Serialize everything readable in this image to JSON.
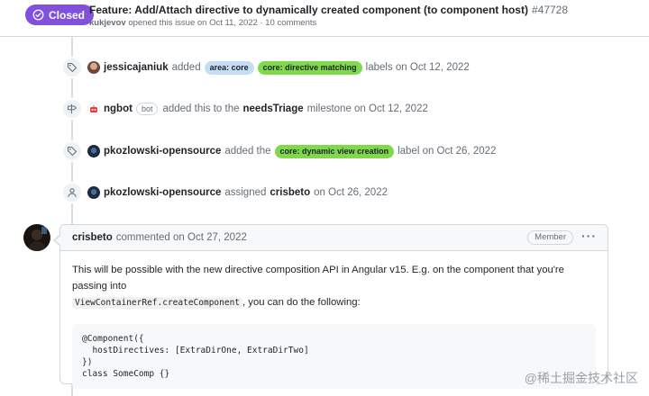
{
  "issue": {
    "state": "Closed",
    "title": "Feature: Add/Attach directive to dynamically created component (to component host)",
    "number": "#47728",
    "author": "kukjevov",
    "opened_text": "opened this issue on Oct 11, 2022 · 10 comments",
    "state_color": "#8250df"
  },
  "timeline": {
    "event1": {
      "icon": "tag-icon",
      "actor": "jessicajaniuk",
      "verb": "added",
      "label1": "area: core",
      "label2": "core: directive matching",
      "suffix": "labels on Oct 12, 2022"
    },
    "event2": {
      "icon": "milestone-icon",
      "actor": "ngbot",
      "bot_badge": "bot",
      "verb": "added this to the",
      "milestone": "needsTriage",
      "suffix": "milestone on Oct 12, 2022"
    },
    "event3": {
      "icon": "tag-icon",
      "actor": "pkozlowski-opensource",
      "verb": "added the",
      "label1": "core: dynamic view creation",
      "suffix": "label on Oct 26, 2022"
    },
    "event4": {
      "icon": "person-icon",
      "actor": "pkozlowski-opensource",
      "verb": "assigned",
      "assignee": "crisbeto",
      "suffix": "on Oct 26, 2022"
    }
  },
  "comment": {
    "author": "crisbeto",
    "meta": "commented on Oct 27, 2022",
    "role_badge": "Member",
    "menu": "···",
    "body_line1": "This will be possible with the new directive composition API in Angular v15. E.g. on the component that you're passing into",
    "inline_code": "ViewContainerRef.createComponent",
    "body_line2_tail": ", you can do the following:",
    "code": "@Component({\n  hostDirectives: [ExtraDirOne, ExtraDirTwo]\n})\nclass SomeComp {}"
  },
  "watermark": "@稀土掘金技术社区",
  "colors": {
    "label_area": "#c5def5",
    "label_green": "#7fd94a"
  }
}
